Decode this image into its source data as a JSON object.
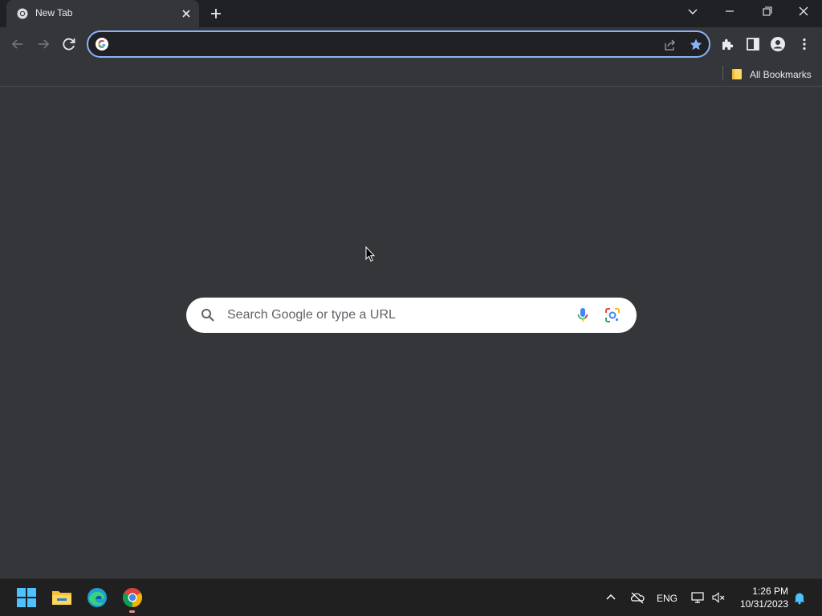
{
  "browser": {
    "tab": {
      "title": "New Tab",
      "favicon": "chrome-icon"
    },
    "new_tab_icon": "plus-icon",
    "window_controls": [
      "tab-search-icon",
      "minimize-icon",
      "restore-icon",
      "close-icon"
    ],
    "omnibox": {
      "value": "",
      "placeholder": "",
      "icons": [
        "google-g-icon",
        "share-icon",
        "star-icon"
      ]
    },
    "toolbar_icons": [
      "extensions-icon",
      "side-panel-icon",
      "profile-icon",
      "menu-icon"
    ],
    "bookmarks_bar": {
      "all_bookmarks_label": "All Bookmarks"
    }
  },
  "ntp": {
    "search": {
      "placeholder": "Search Google or type a URL",
      "value": ""
    }
  },
  "taskbar": {
    "apps": [
      "start-icon",
      "file-explorer-icon",
      "edge-icon",
      "chrome-icon"
    ],
    "language": "ENG",
    "time": "1:26 PM",
    "date": "10/31/2023"
  },
  "colors": {
    "accent": "#8ab4f8",
    "page_bg": "#35363a",
    "tabstrip_bg": "#202124",
    "taskbar_bg": "#202020"
  }
}
